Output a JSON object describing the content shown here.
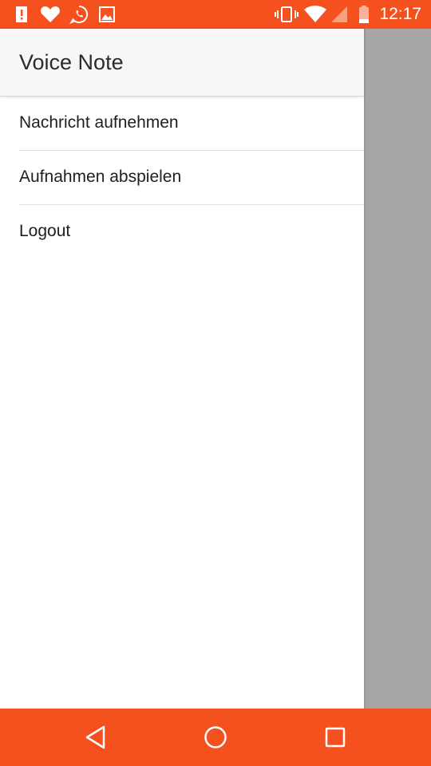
{
  "status_bar": {
    "time": "12:17",
    "background": "#f4511e",
    "left_icons": [
      "alert-icon",
      "heart-icon",
      "whatsapp-icon",
      "image-icon"
    ],
    "right_icons": [
      "vibrate-icon",
      "wifi-icon",
      "signal-icon",
      "battery-icon"
    ]
  },
  "drawer": {
    "title": "Voice Note",
    "items": [
      {
        "label": "Nachricht aufnehmen"
      },
      {
        "label": "Aufnahmen abspielen"
      },
      {
        "label": "Logout"
      }
    ]
  },
  "nav_bar": {
    "background": "#f4511e",
    "buttons": [
      "back-icon",
      "home-icon",
      "recents-icon"
    ]
  }
}
